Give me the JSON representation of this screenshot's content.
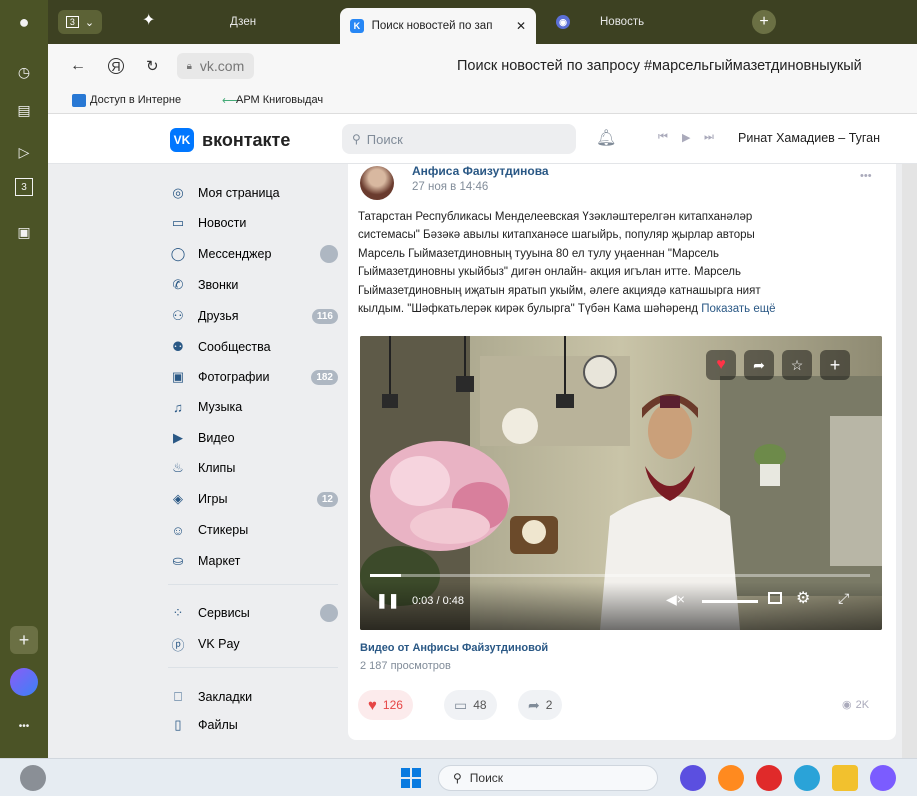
{
  "browser": {
    "tabs": [
      {
        "label": "Дзен"
      },
      {
        "label": "Поиск новостей по зап"
      },
      {
        "label": "Новость"
      }
    ],
    "address": "vk.com",
    "page_title": "Поиск новостей по запросу #марсельгыймазетдиновныукый",
    "bookmarks": [
      "Доступ в Интерне",
      "АРМ Книговыдач"
    ]
  },
  "vk": {
    "logo": "вконтакте",
    "search_placeholder": "Поиск",
    "now_playing": "Ринат Хамадиев – Туган"
  },
  "menu": {
    "items": [
      {
        "label": "Моя страница",
        "icon": "user-circle-icon",
        "glyph": "◎"
      },
      {
        "label": "Новости",
        "icon": "news-icon",
        "glyph": "▭"
      },
      {
        "label": "Мессенджер",
        "icon": "message-icon",
        "glyph": "◯",
        "badge": ""
      },
      {
        "label": "Звонки",
        "icon": "phone-icon",
        "glyph": "✆"
      },
      {
        "label": "Друзья",
        "icon": "friends-icon",
        "glyph": "⚇",
        "badge": "116"
      },
      {
        "label": "Сообщества",
        "icon": "communities-icon",
        "glyph": "⚉"
      },
      {
        "label": "Фотографии",
        "icon": "photo-icon",
        "glyph": "▣",
        "badge": "182"
      },
      {
        "label": "Музыка",
        "icon": "music-icon",
        "glyph": "♫"
      },
      {
        "label": "Видео",
        "icon": "video-icon",
        "glyph": "▶"
      },
      {
        "label": "Клипы",
        "icon": "clips-icon",
        "glyph": "♨"
      },
      {
        "label": "Игры",
        "icon": "games-icon",
        "glyph": "◈",
        "badge": "12"
      },
      {
        "label": "Стикеры",
        "icon": "sticker-icon",
        "glyph": "☺"
      },
      {
        "label": "Маркет",
        "icon": "market-icon",
        "glyph": "⛀"
      }
    ],
    "items2": [
      {
        "label": "Сервисы",
        "icon": "services-icon",
        "glyph": "⁘",
        "badge": ""
      },
      {
        "label": "VK Pay",
        "icon": "vkpay-icon",
        "glyph": "ⓟ"
      }
    ],
    "items3": [
      {
        "label": "Закладки",
        "icon": "bookmark-icon",
        "glyph": "⎕"
      },
      {
        "label": "Файлы",
        "icon": "files-icon",
        "glyph": "▯"
      }
    ]
  },
  "post": {
    "author": "Анфиса Фаизутдинова",
    "date": "27 ноя в 14:46",
    "text_lines": [
      "Татарстан Республикасы Менделеевская Үзәкләштерелгән китапханәләр",
      "системасы\" Бәзәкә авылы китапханәсе шагыйрь, популяр җырлар авторы",
      "Марсель Гыймазетдиновның тууына 80 ел тулу уңаеннан \"Марсель",
      "Гыймазетдиновны укыйбыз\" дигән онлайн- акция игълан итте. Марсель",
      "Гыймазетдиновның иҗатын яратып укыйм, әлеге акциядә катнашырга ният",
      "кылдым. \"Шәфкатьлерәк кирәк булырга\" Түбән Кама шәһәренд"
    ],
    "show_more": "Показать ещё",
    "video": {
      "time": "0:03 / 0:48",
      "progress": 0.0625,
      "title": "Видео от Анфисы Файзутдиновой",
      "views": "2 187 просмотров"
    },
    "likes": "126",
    "comments": "48",
    "shares": "2",
    "post_views": "2K"
  },
  "taskbar": {
    "search": "Поиск"
  },
  "colors": {
    "vk_blue": "#2a5885",
    "like_red": "#e64646",
    "browser_olive": "#4b5326"
  }
}
